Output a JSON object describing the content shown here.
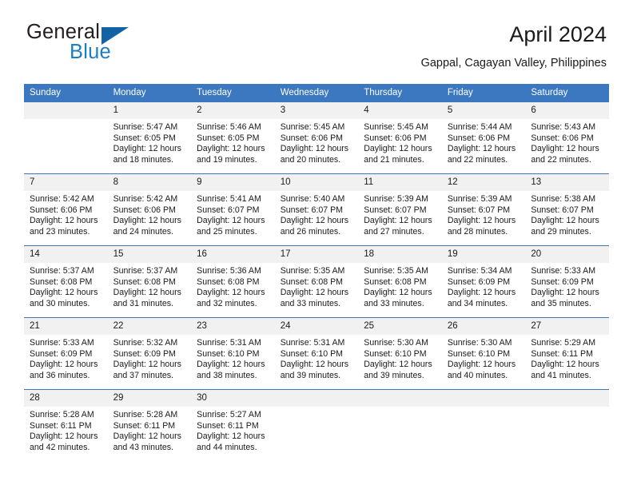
{
  "brand": {
    "name_part1": "General",
    "name_part2": "Blue",
    "logo_icon": "triangle-logo-icon"
  },
  "header": {
    "month_title": "April 2024",
    "location": "Gappal, Cagayan Valley, Philippines"
  },
  "theme": {
    "header_blue": "#3b78bf",
    "brand_blue": "#1a7fc1",
    "daynum_band": "#f1f1f1",
    "text": "#1a1a1a"
  },
  "weekday_headers": [
    "Sunday",
    "Monday",
    "Tuesday",
    "Wednesday",
    "Thursday",
    "Friday",
    "Saturday"
  ],
  "weeks": [
    [
      {
        "day": "",
        "empty": true,
        "sunrise": "",
        "sunset": "",
        "daylight_1": "",
        "daylight_2": ""
      },
      {
        "day": "1",
        "sunrise": "Sunrise: 5:47 AM",
        "sunset": "Sunset: 6:05 PM",
        "daylight_1": "Daylight: 12 hours",
        "daylight_2": "and 18 minutes."
      },
      {
        "day": "2",
        "sunrise": "Sunrise: 5:46 AM",
        "sunset": "Sunset: 6:05 PM",
        "daylight_1": "Daylight: 12 hours",
        "daylight_2": "and 19 minutes."
      },
      {
        "day": "3",
        "sunrise": "Sunrise: 5:45 AM",
        "sunset": "Sunset: 6:06 PM",
        "daylight_1": "Daylight: 12 hours",
        "daylight_2": "and 20 minutes."
      },
      {
        "day": "4",
        "sunrise": "Sunrise: 5:45 AM",
        "sunset": "Sunset: 6:06 PM",
        "daylight_1": "Daylight: 12 hours",
        "daylight_2": "and 21 minutes."
      },
      {
        "day": "5",
        "sunrise": "Sunrise: 5:44 AM",
        "sunset": "Sunset: 6:06 PM",
        "daylight_1": "Daylight: 12 hours",
        "daylight_2": "and 22 minutes."
      },
      {
        "day": "6",
        "sunrise": "Sunrise: 5:43 AM",
        "sunset": "Sunset: 6:06 PM",
        "daylight_1": "Daylight: 12 hours",
        "daylight_2": "and 22 minutes."
      }
    ],
    [
      {
        "day": "7",
        "sunrise": "Sunrise: 5:42 AM",
        "sunset": "Sunset: 6:06 PM",
        "daylight_1": "Daylight: 12 hours",
        "daylight_2": "and 23 minutes."
      },
      {
        "day": "8",
        "sunrise": "Sunrise: 5:42 AM",
        "sunset": "Sunset: 6:06 PM",
        "daylight_1": "Daylight: 12 hours",
        "daylight_2": "and 24 minutes."
      },
      {
        "day": "9",
        "sunrise": "Sunrise: 5:41 AM",
        "sunset": "Sunset: 6:07 PM",
        "daylight_1": "Daylight: 12 hours",
        "daylight_2": "and 25 minutes."
      },
      {
        "day": "10",
        "sunrise": "Sunrise: 5:40 AM",
        "sunset": "Sunset: 6:07 PM",
        "daylight_1": "Daylight: 12 hours",
        "daylight_2": "and 26 minutes."
      },
      {
        "day": "11",
        "sunrise": "Sunrise: 5:39 AM",
        "sunset": "Sunset: 6:07 PM",
        "daylight_1": "Daylight: 12 hours",
        "daylight_2": "and 27 minutes."
      },
      {
        "day": "12",
        "sunrise": "Sunrise: 5:39 AM",
        "sunset": "Sunset: 6:07 PM",
        "daylight_1": "Daylight: 12 hours",
        "daylight_2": "and 28 minutes."
      },
      {
        "day": "13",
        "sunrise": "Sunrise: 5:38 AM",
        "sunset": "Sunset: 6:07 PM",
        "daylight_1": "Daylight: 12 hours",
        "daylight_2": "and 29 minutes."
      }
    ],
    [
      {
        "day": "14",
        "sunrise": "Sunrise: 5:37 AM",
        "sunset": "Sunset: 6:08 PM",
        "daylight_1": "Daylight: 12 hours",
        "daylight_2": "and 30 minutes."
      },
      {
        "day": "15",
        "sunrise": "Sunrise: 5:37 AM",
        "sunset": "Sunset: 6:08 PM",
        "daylight_1": "Daylight: 12 hours",
        "daylight_2": "and 31 minutes."
      },
      {
        "day": "16",
        "sunrise": "Sunrise: 5:36 AM",
        "sunset": "Sunset: 6:08 PM",
        "daylight_1": "Daylight: 12 hours",
        "daylight_2": "and 32 minutes."
      },
      {
        "day": "17",
        "sunrise": "Sunrise: 5:35 AM",
        "sunset": "Sunset: 6:08 PM",
        "daylight_1": "Daylight: 12 hours",
        "daylight_2": "and 33 minutes."
      },
      {
        "day": "18",
        "sunrise": "Sunrise: 5:35 AM",
        "sunset": "Sunset: 6:08 PM",
        "daylight_1": "Daylight: 12 hours",
        "daylight_2": "and 33 minutes."
      },
      {
        "day": "19",
        "sunrise": "Sunrise: 5:34 AM",
        "sunset": "Sunset: 6:09 PM",
        "daylight_1": "Daylight: 12 hours",
        "daylight_2": "and 34 minutes."
      },
      {
        "day": "20",
        "sunrise": "Sunrise: 5:33 AM",
        "sunset": "Sunset: 6:09 PM",
        "daylight_1": "Daylight: 12 hours",
        "daylight_2": "and 35 minutes."
      }
    ],
    [
      {
        "day": "21",
        "sunrise": "Sunrise: 5:33 AM",
        "sunset": "Sunset: 6:09 PM",
        "daylight_1": "Daylight: 12 hours",
        "daylight_2": "and 36 minutes."
      },
      {
        "day": "22",
        "sunrise": "Sunrise: 5:32 AM",
        "sunset": "Sunset: 6:09 PM",
        "daylight_1": "Daylight: 12 hours",
        "daylight_2": "and 37 minutes."
      },
      {
        "day": "23",
        "sunrise": "Sunrise: 5:31 AM",
        "sunset": "Sunset: 6:10 PM",
        "daylight_1": "Daylight: 12 hours",
        "daylight_2": "and 38 minutes."
      },
      {
        "day": "24",
        "sunrise": "Sunrise: 5:31 AM",
        "sunset": "Sunset: 6:10 PM",
        "daylight_1": "Daylight: 12 hours",
        "daylight_2": "and 39 minutes."
      },
      {
        "day": "25",
        "sunrise": "Sunrise: 5:30 AM",
        "sunset": "Sunset: 6:10 PM",
        "daylight_1": "Daylight: 12 hours",
        "daylight_2": "and 39 minutes."
      },
      {
        "day": "26",
        "sunrise": "Sunrise: 5:30 AM",
        "sunset": "Sunset: 6:10 PM",
        "daylight_1": "Daylight: 12 hours",
        "daylight_2": "and 40 minutes."
      },
      {
        "day": "27",
        "sunrise": "Sunrise: 5:29 AM",
        "sunset": "Sunset: 6:11 PM",
        "daylight_1": "Daylight: 12 hours",
        "daylight_2": "and 41 minutes."
      }
    ],
    [
      {
        "day": "28",
        "sunrise": "Sunrise: 5:28 AM",
        "sunset": "Sunset: 6:11 PM",
        "daylight_1": "Daylight: 12 hours",
        "daylight_2": "and 42 minutes."
      },
      {
        "day": "29",
        "sunrise": "Sunrise: 5:28 AM",
        "sunset": "Sunset: 6:11 PM",
        "daylight_1": "Daylight: 12 hours",
        "daylight_2": "and 43 minutes."
      },
      {
        "day": "30",
        "sunrise": "Sunrise: 5:27 AM",
        "sunset": "Sunset: 6:11 PM",
        "daylight_1": "Daylight: 12 hours",
        "daylight_2": "and 44 minutes."
      },
      {
        "day": "",
        "empty": true,
        "sunrise": "",
        "sunset": "",
        "daylight_1": "",
        "daylight_2": ""
      },
      {
        "day": "",
        "empty": true,
        "sunrise": "",
        "sunset": "",
        "daylight_1": "",
        "daylight_2": ""
      },
      {
        "day": "",
        "empty": true,
        "sunrise": "",
        "sunset": "",
        "daylight_1": "",
        "daylight_2": ""
      },
      {
        "day": "",
        "empty": true,
        "sunrise": "",
        "sunset": "",
        "daylight_1": "",
        "daylight_2": ""
      }
    ]
  ]
}
